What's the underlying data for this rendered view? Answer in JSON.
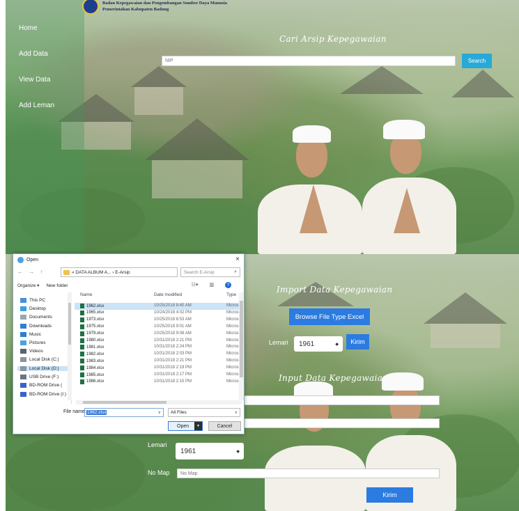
{
  "top_page": {
    "nav": [
      "Home",
      "Add Data",
      "View Data",
      "Add Leman"
    ],
    "logo_line1": "Badan Kepegawaian dan Pengembangan Sumber Daya Manusia",
    "logo_line2": "Pemerintahan Kabupaten Badung",
    "heading": "Cari Arsip Kepegawaian",
    "nip_placeholder": "NIP",
    "search_label": "Search"
  },
  "bottom_page": {
    "import_heading": "Import Data Kepegawaian",
    "browse_label": "Browse File Type Excel",
    "lemari_label": "Lemari",
    "lemari_value": "1961",
    "kirim_label": "Kirim",
    "input_heading": "Input Data Kepegawaian",
    "form_lemari_label": "Lemari",
    "form_lemari_value": "1961",
    "no_map_label": "No Map",
    "no_map_placeholder": "No Map",
    "submit_label": "Kirim"
  },
  "dialog": {
    "title": "Open",
    "close": "×",
    "nav_arrows": "← → ↑",
    "path": "« DATA ALBUM A... › E-Arsip",
    "search_placeholder": "Search E-Arsip",
    "organize": "Organize ▾",
    "new_folder": "New folder",
    "nav_items": [
      {
        "label": "This PC",
        "color": "#4a90d9"
      },
      {
        "label": "Desktop",
        "color": "#3aa0e6"
      },
      {
        "label": "Documents",
        "color": "#9aa6b2"
      },
      {
        "label": "Downloads",
        "color": "#2f7fd1"
      },
      {
        "label": "Music",
        "color": "#2f7fd1"
      },
      {
        "label": "Pictures",
        "color": "#4aa3df"
      },
      {
        "label": "Videos",
        "color": "#5a6470"
      },
      {
        "label": "Local Disk (C:)",
        "color": "#8a96a2"
      },
      {
        "label": "Local Disk (D:)",
        "color": "#8a96a2"
      },
      {
        "label": "USB Drive (F:)",
        "color": "#6b7580"
      },
      {
        "label": "BD-ROM Drive (",
        "color": "#3a63c9"
      },
      {
        "label": "BD-ROM Drive (I:) ∨",
        "color": "#3a63c9"
      }
    ],
    "columns": {
      "name": "Name",
      "date": "Date modified",
      "type": "Type"
    },
    "files": [
      {
        "name": "1962.xlsx",
        "date": "10/25/2018 8:40 AM",
        "type": "Micros"
      },
      {
        "name": "1965.xlsx",
        "date": "10/24/2018 4:02 PM",
        "type": "Micros"
      },
      {
        "name": "1973.xlsx",
        "date": "10/25/2018 8:53 AM",
        "type": "Micros"
      },
      {
        "name": "1975.xlsx",
        "date": "10/25/2018 9:01 AM",
        "type": "Micros"
      },
      {
        "name": "1979.xlsx",
        "date": "10/25/2018 9:08 AM",
        "type": "Micros"
      },
      {
        "name": "1980.xlsx",
        "date": "10/31/2018 2:21 PM",
        "type": "Micros"
      },
      {
        "name": "1981.xlsx",
        "date": "10/31/2018 2:24 PM",
        "type": "Micros"
      },
      {
        "name": "1982.xlsx",
        "date": "10/31/2018 2:03 PM",
        "type": "Micros"
      },
      {
        "name": "1983.xlsx",
        "date": "10/31/2018 2:21 PM",
        "type": "Micros"
      },
      {
        "name": "1984.xlsx",
        "date": "10/31/2018 2:19 PM",
        "type": "Micros"
      },
      {
        "name": "1985.xlsx",
        "date": "10/31/2018 2:17 PM",
        "type": "Micros"
      },
      {
        "name": "1986.xlsx",
        "date": "10/31/2018 2:15 PM",
        "type": "Micros"
      }
    ],
    "file_name_label": "File name:",
    "file_name_value": "1962.xlsx",
    "file_type": "All Files",
    "open_label": "Open",
    "cancel_label": "Cancel"
  }
}
